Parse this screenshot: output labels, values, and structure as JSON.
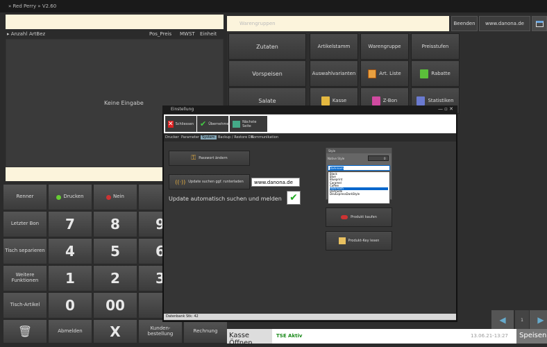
{
  "app": {
    "title": "» Red Perry » V2.60"
  },
  "left": {
    "columns": [
      "▸ Anzahl",
      "ArtBez",
      "Pos_Preis",
      "MWST",
      "Einheit"
    ],
    "empty_message": "Keine Eingabe"
  },
  "keypad": {
    "row1": {
      "a": "Renner",
      "b": "Drucken",
      "c": "Nein"
    },
    "row2": {
      "a": "Letzter Bon",
      "n1": "7",
      "n2": "8",
      "n3": "9"
    },
    "row3": {
      "a": "Tisch separieren",
      "n1": "4",
      "n2": "5",
      "n3": "6"
    },
    "row4": {
      "a": "Weitere Funktionen",
      "n1": "1",
      "n2": "2",
      "n3": "3"
    },
    "row5": {
      "a": "Tisch-Artikel",
      "n1": "0",
      "n2": "00"
    },
    "row6": {
      "b": "Abmelden",
      "c": "X",
      "d": "Kunden-bestellung",
      "e": "Rechnung"
    }
  },
  "right": {
    "warengruppen": "Warengruppen",
    "beenden": "Beenden",
    "website": "www.danona.de",
    "categories": [
      "Zutaten",
      "Vorspeisen",
      "Salate"
    ],
    "grid": [
      [
        "Artikelstamm",
        "Warengruppe",
        "Preisstufen"
      ],
      [
        "Auswahlvarianten",
        "Art. Liste",
        "Rabatte"
      ],
      [
        "",
        "Kasse",
        "Z-Bon",
        "Statistiken"
      ]
    ]
  },
  "dialog": {
    "title": "Einstellung",
    "controls": "— ▫ ✕",
    "toolbar": {
      "close": "Schliessen",
      "apply": "Übernehmen",
      "next": "Nächste Seite"
    },
    "tabs": [
      "Drucker",
      "Parameter",
      "System",
      "Backup / Restore DB",
      "Kommunikation"
    ],
    "password_btn": "Passwort ändern",
    "update_btn": "Update suchen ggf. runterladen",
    "update_url": "www.danona.de",
    "auto_update_label": "Update automatisch suchen und melden",
    "style": {
      "heading": "Style",
      "native_label": "Native Style",
      "native_value": "0",
      "selected": "Darkroom",
      "options": [
        "Black",
        "Blue",
        "Blueprint",
        "Caramel",
        "Coffee",
        "Darkroom",
        "DarkSide",
        "DevExpressDarkStyle"
      ]
    },
    "buy_btn": "Produkt kaufen",
    "key_btn": "Produkt-Key lesen",
    "status": "Datenbank Stk: 42"
  },
  "bottom": {
    "kasse": "Kasse Öffnen",
    "tse": "TSE Aktiv",
    "timestamp": "13.06.21-13:27",
    "speisen": "Speisen",
    "nav_mid": "1"
  }
}
